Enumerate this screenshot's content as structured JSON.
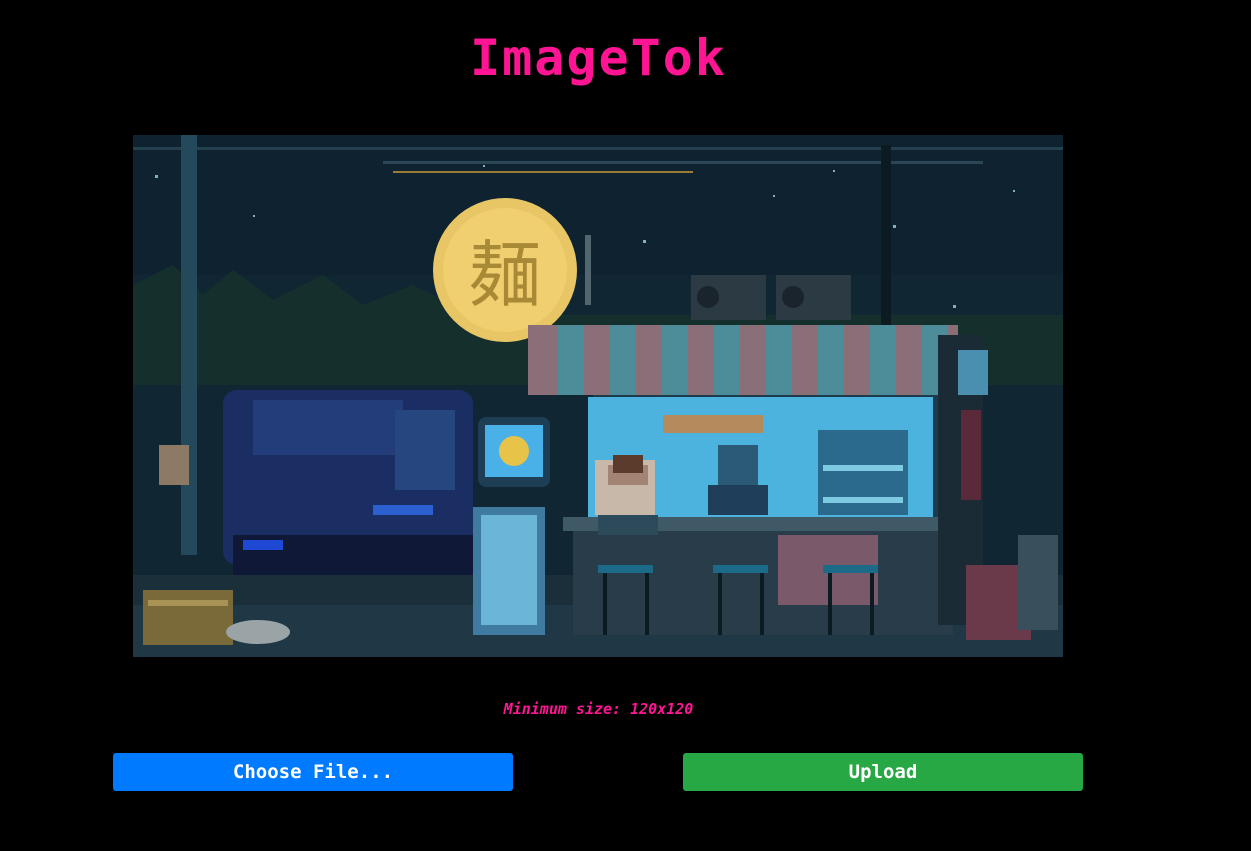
{
  "app": {
    "title": "ImageTok"
  },
  "image": {
    "sign_text": "麺",
    "depicts": "pixel-art-noodle-stand-icon"
  },
  "upload": {
    "hint": "Minimum size: 120x120",
    "choose_label": "Choose File...",
    "upload_label": "Upload"
  },
  "colors": {
    "title": "#ff1493",
    "choose_button": "#007bff",
    "upload_button": "#28a745",
    "background": "#000000"
  }
}
